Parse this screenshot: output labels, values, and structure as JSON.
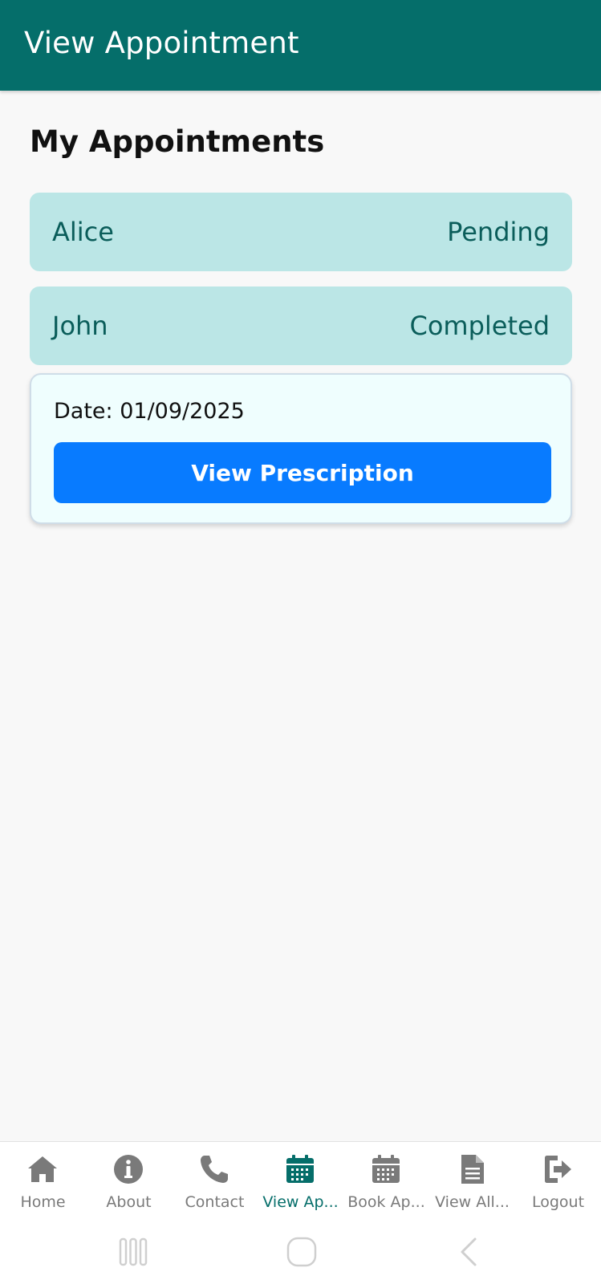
{
  "app_bar": {
    "title": "View Appointment",
    "color": "#056e6a"
  },
  "section": {
    "title": "My Appointments"
  },
  "appointments": [
    {
      "name": "Alice",
      "status": "Pending"
    },
    {
      "name": "John",
      "status": "Completed"
    }
  ],
  "details": {
    "date_text": "Date: 01/09/2025",
    "button_label": "View Prescription",
    "button_color": "#087bff"
  },
  "bottom_nav": {
    "items": [
      {
        "label": "Home",
        "icon": "home-icon"
      },
      {
        "label": "About",
        "icon": "info-icon"
      },
      {
        "label": "Contact",
        "icon": "phone-icon"
      },
      {
        "label": "View Ap...",
        "icon": "calendar-icon",
        "active": true
      },
      {
        "label": "Book Ap...",
        "icon": "calendar-icon"
      },
      {
        "label": "View All...",
        "icon": "document-icon"
      },
      {
        "label": "Logout",
        "icon": "logout-icon"
      }
    ],
    "active_color": "#056e6a",
    "inactive_color": "#7a7a7a"
  },
  "system_nav": {
    "icons": [
      "recents-icon",
      "home-button-icon",
      "back-icon"
    ]
  }
}
